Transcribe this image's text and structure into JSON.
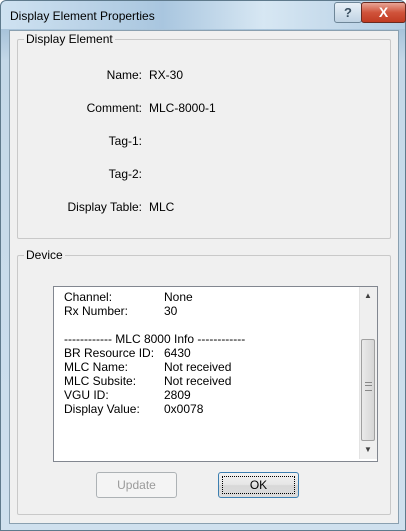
{
  "window": {
    "title": "Display Element Properties",
    "help_glyph": "?",
    "close_glyph": "X"
  },
  "display_element": {
    "legend": "Display Element",
    "name_label": "Name:",
    "name_value": "RX-30",
    "comment_label": "Comment:",
    "comment_value": "MLC-8000-1",
    "tag1_label": "Tag-1:",
    "tag1_value": "",
    "tag2_label": "Tag-2:",
    "tag2_value": "",
    "display_table_label": "Display Table:",
    "display_table_value": "MLC"
  },
  "device": {
    "legend": "Device",
    "rows": [
      {
        "key": "Channel:",
        "value": "None"
      },
      {
        "key": "Rx Number:",
        "value": "30"
      },
      {
        "key": "",
        "value": ""
      },
      {
        "caption": "------------ MLC 8000 Info ------------"
      },
      {
        "key": "BR Resource ID:",
        "value": "6430"
      },
      {
        "key": "MLC Name:",
        "value": "Not received"
      },
      {
        "key": "MLC Subsite:",
        "value": "Not received"
      },
      {
        "key": "VGU ID:",
        "value": "2809"
      },
      {
        "key": "Display Value:",
        "value": "0x0078"
      }
    ],
    "scroll_up": "▲",
    "scroll_down": "▼"
  },
  "buttons": {
    "update_label": "Update",
    "ok_label": "OK"
  },
  "colors": {
    "title_bar": "#a9c6df",
    "close_button": "#c13b22",
    "dialog_face": "#f0f0f0"
  }
}
